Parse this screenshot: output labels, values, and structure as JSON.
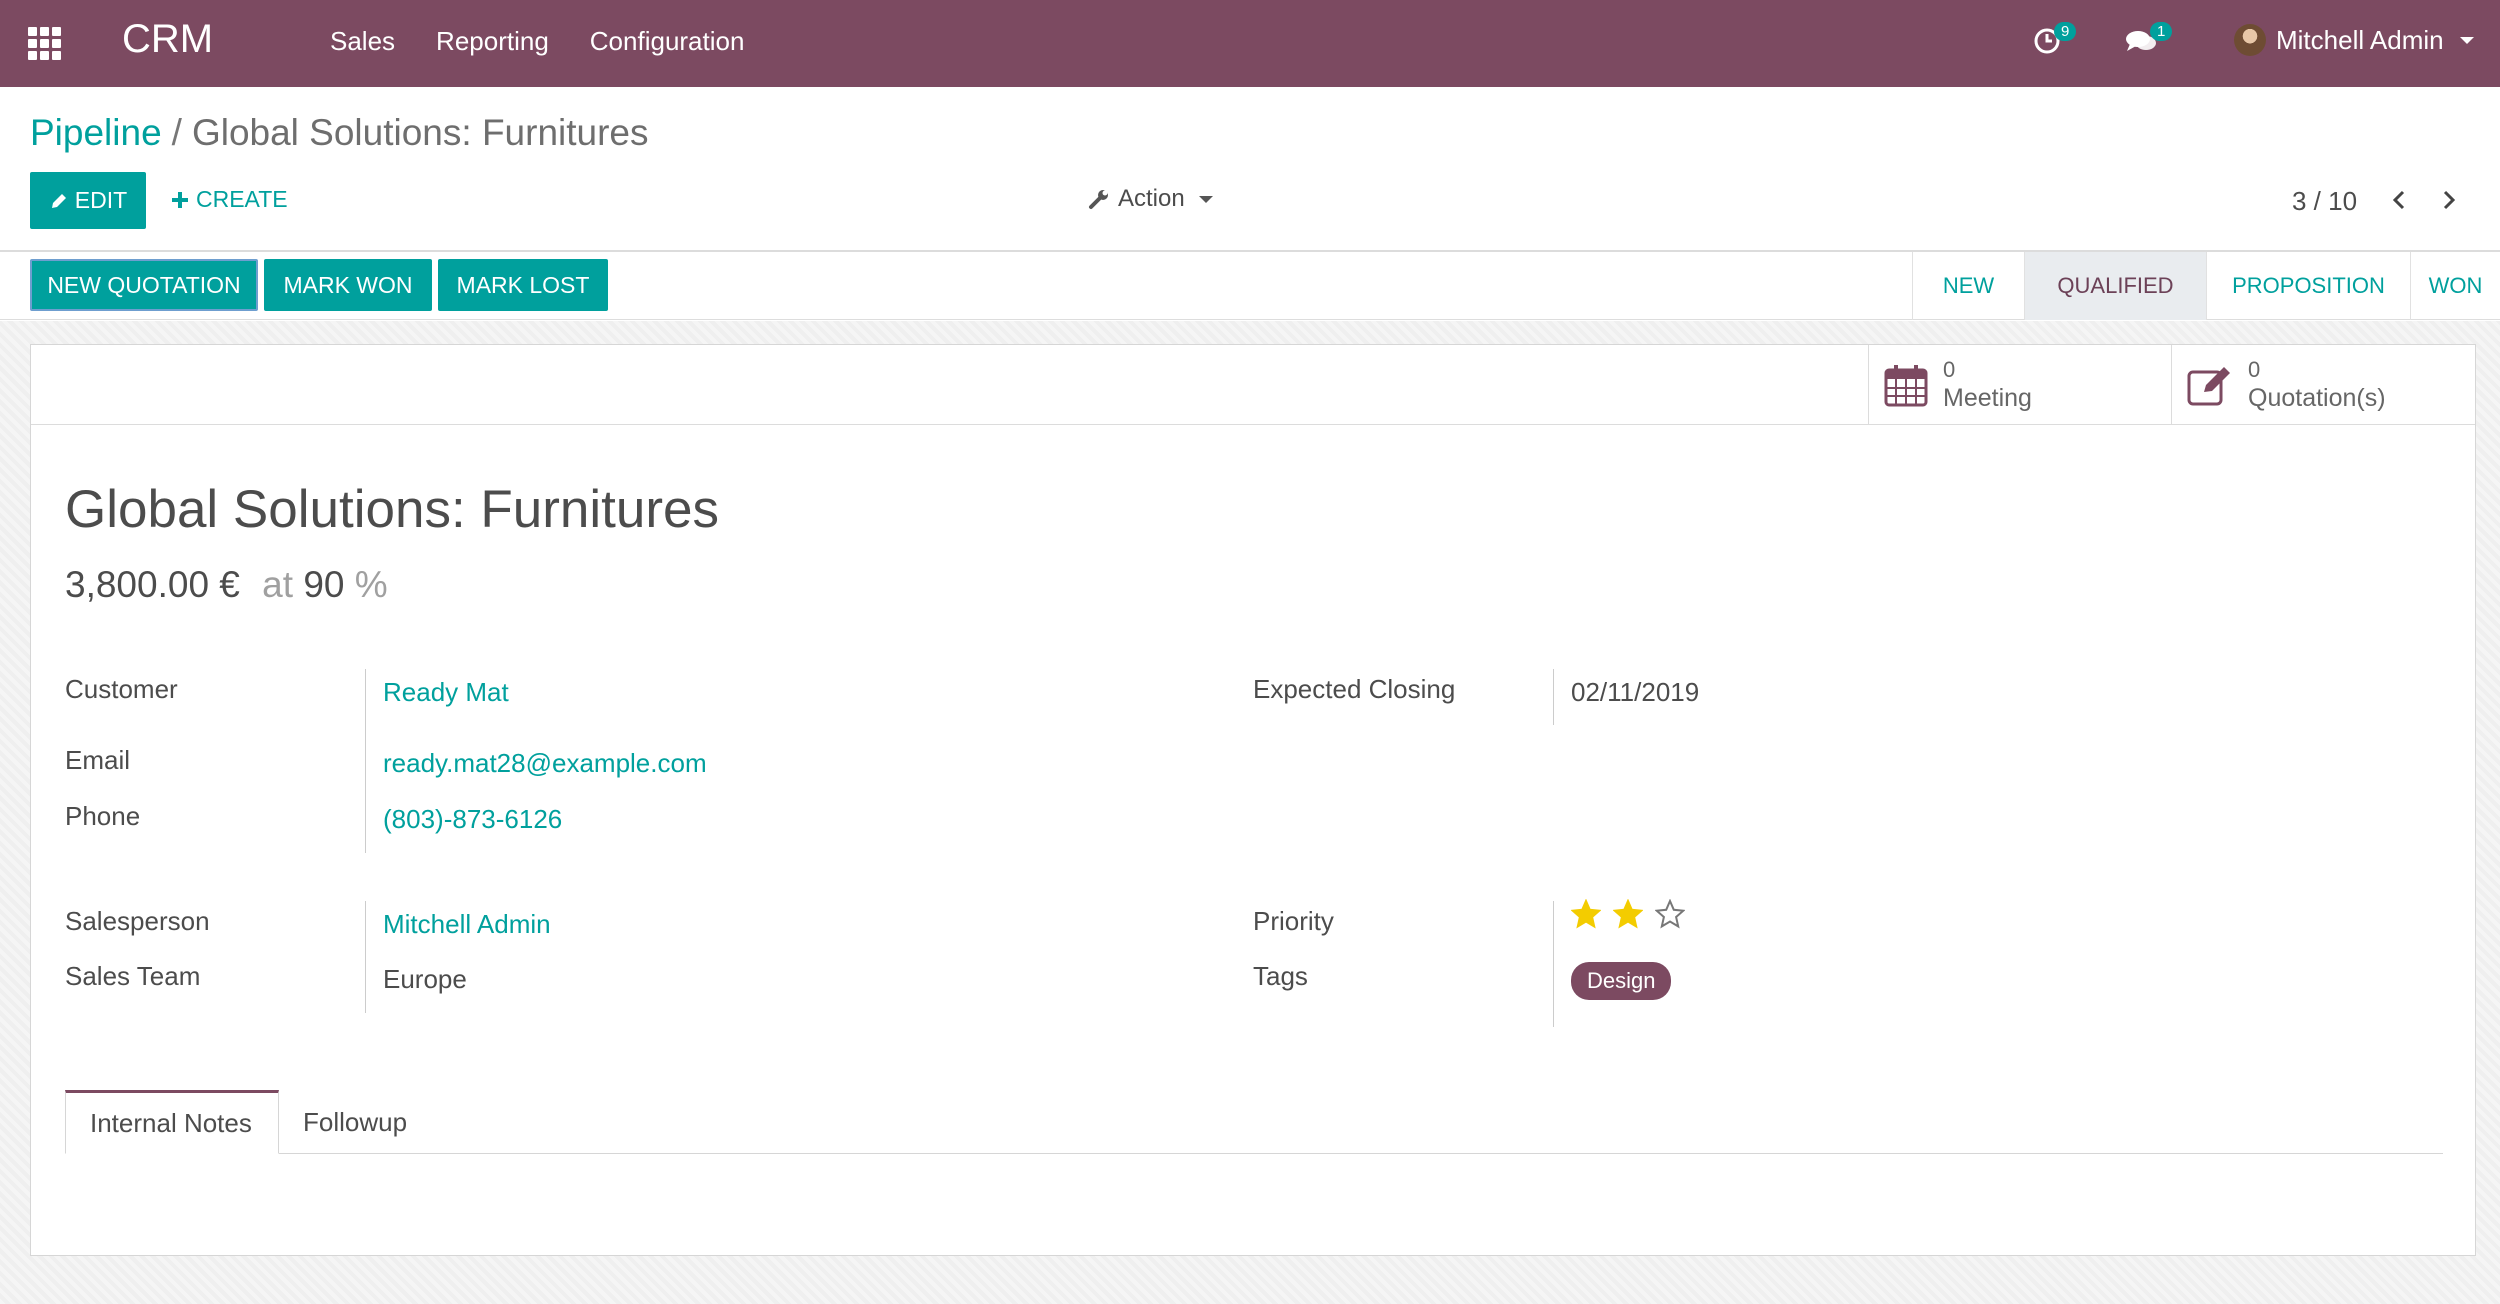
{
  "navbar": {
    "app_name": "CRM",
    "menu": [
      "Sales",
      "Reporting",
      "Configuration"
    ],
    "activity_badge": "9",
    "message_badge": "1",
    "user_name": "Mitchell Admin"
  },
  "breadcrumb": {
    "parent": "Pipeline",
    "separator": "/",
    "current": "Global Solutions: Furnitures"
  },
  "toolbar": {
    "edit_label": "EDIT",
    "create_label": "CREATE",
    "action_label": "Action",
    "pager": "3 / 10"
  },
  "statusbar": {
    "buttons": [
      "NEW QUOTATION",
      "MARK WON",
      "MARK LOST"
    ],
    "stages": [
      "NEW",
      "QUALIFIED",
      "PROPOSITION",
      "WON"
    ],
    "active_stage": "QUALIFIED"
  },
  "smart_buttons": {
    "meeting": {
      "count": "0",
      "label": "Meeting"
    },
    "quotations": {
      "count": "0",
      "label": "Quotation(s)"
    }
  },
  "record": {
    "title": "Global Solutions: Furnitures",
    "revenue": "3,800.00 €",
    "at_label": "at",
    "probability": "90",
    "percent_sign": "%",
    "fields": {
      "customer_label": "Customer",
      "customer": "Ready Mat",
      "email_label": "Email",
      "email": "ready.mat28@example.com",
      "phone_label": "Phone",
      "phone": "(803)-873-6126",
      "closing_label": "Expected Closing",
      "closing": "02/11/2019",
      "salesperson_label": "Salesperson",
      "salesperson": "Mitchell Admin",
      "team_label": "Sales Team",
      "team": "Europe",
      "priority_label": "Priority",
      "priority_stars": 2,
      "priority_max": 3,
      "tags_label": "Tags",
      "tags": [
        "Design"
      ]
    }
  },
  "tabs": [
    "Internal Notes",
    "Followup"
  ],
  "colors": {
    "brand": "#7c4a61",
    "accent": "#00a09d",
    "star": "#f3cc00"
  }
}
